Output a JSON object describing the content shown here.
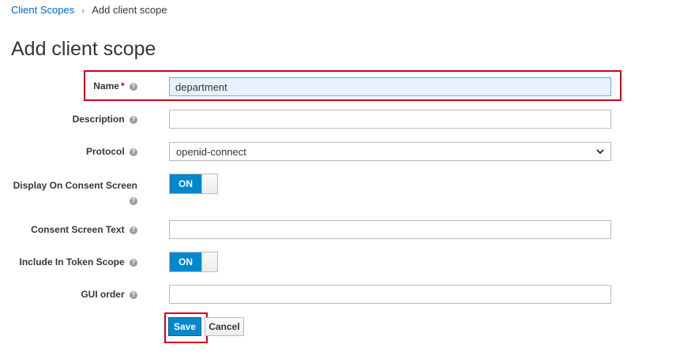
{
  "breadcrumb": {
    "parent": "Client Scopes",
    "separator": "›",
    "current": "Add client scope"
  },
  "page_title": "Add client scope",
  "form": {
    "name": {
      "label": "Name",
      "required_mark": "*",
      "value": "department"
    },
    "description": {
      "label": "Description",
      "value": ""
    },
    "protocol": {
      "label": "Protocol",
      "selected": "openid-connect"
    },
    "display_on_consent": {
      "label_line1": "Display On Consent Screen",
      "toggle": "ON"
    },
    "consent_text": {
      "label": "Consent Screen Text",
      "value": ""
    },
    "include_in_token": {
      "label": "Include In Token Scope",
      "toggle": "ON"
    },
    "gui_order": {
      "label": "GUI order",
      "value": ""
    }
  },
  "buttons": {
    "save": "Save",
    "cancel": "Cancel"
  },
  "help_glyph": "?",
  "colors": {
    "accent": "#0088ce",
    "highlight": "#d0021b",
    "link": "#0066cc"
  }
}
